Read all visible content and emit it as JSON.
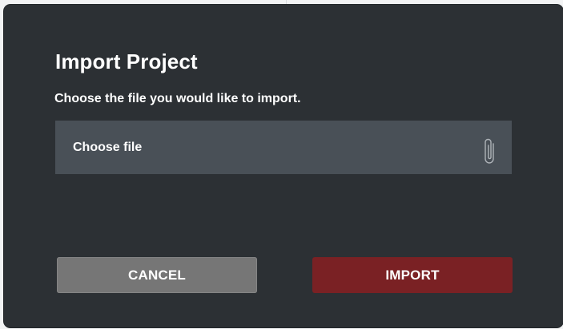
{
  "dialog": {
    "title": "Import Project",
    "subtitle": "Choose the file you would like to import.",
    "file_picker": {
      "label": "Choose file",
      "icon": "paperclip-icon"
    },
    "buttons": {
      "cancel_label": "CANCEL",
      "import_label": "IMPORT"
    }
  },
  "colors": {
    "dialog_bg": "#2c3034",
    "file_picker_bg": "#495057",
    "cancel_bg": "#767676",
    "import_bg": "#7a2124",
    "text": "#ffffff"
  }
}
